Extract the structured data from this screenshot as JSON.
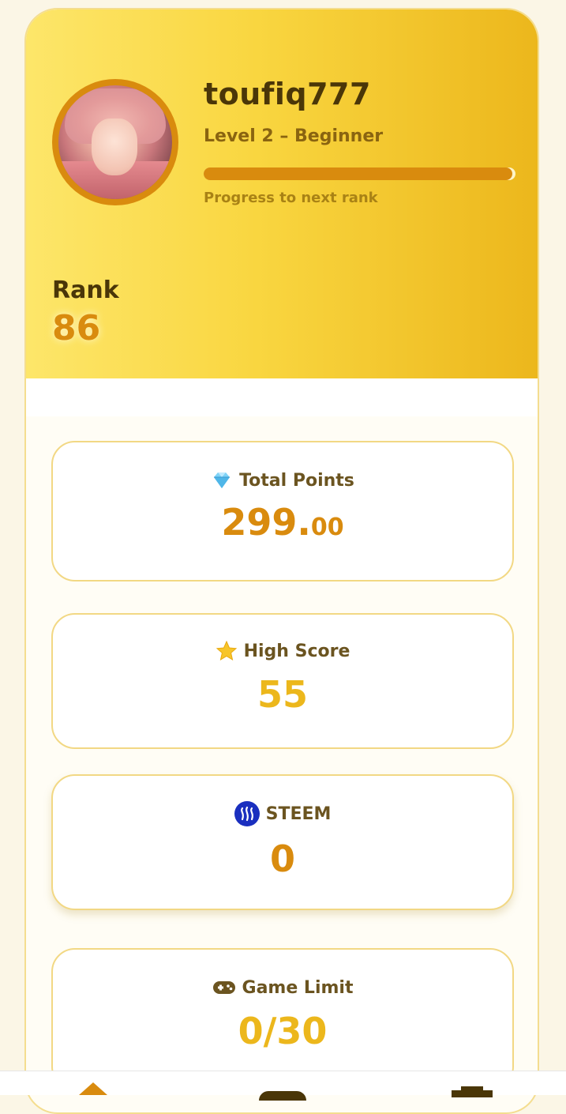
{
  "profile": {
    "username": "toufiq777",
    "level": "Level 2 – Beginner",
    "progress_fraction": 0.99,
    "progress_caption": "Progress to next rank",
    "rank_label": "Rank",
    "rank_value": "86"
  },
  "stats": {
    "total_points": {
      "label": "Total Points",
      "value_int": "299.",
      "value_dec": "00",
      "icon": "gem-icon"
    },
    "high_score": {
      "label": "High Score",
      "value": "55",
      "icon": "star-icon"
    },
    "steem": {
      "label": "STEEM",
      "value": "0",
      "icon": "steem-icon"
    },
    "game_limit": {
      "label": "Game Limit",
      "value": "0/30",
      "icon": "gamepad-icon"
    }
  },
  "colors": {
    "accent": "#d98b0e",
    "gold": "#ecb71c",
    "text_dark": "#4a3608"
  },
  "nav": {
    "items": [
      "home-icon",
      "gamepad-icon",
      "leaderboard-icon"
    ]
  }
}
